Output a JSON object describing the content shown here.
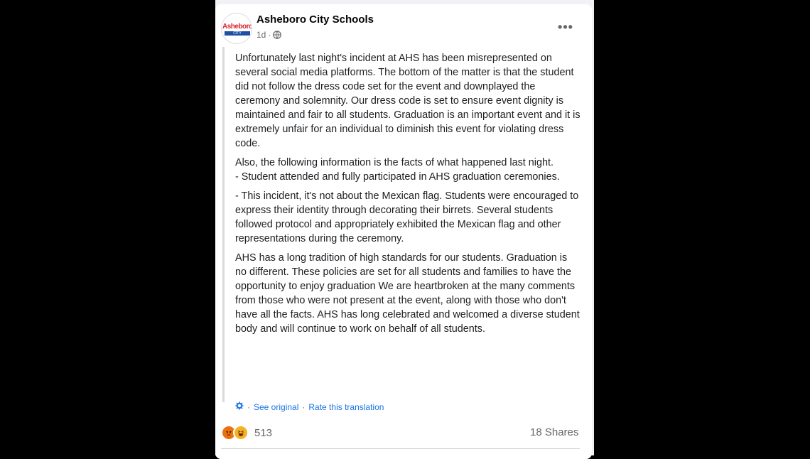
{
  "post": {
    "page_name": "Asheboro City Schools",
    "avatar_text": "Asheboro",
    "avatar_subtext": "CITY SCHOOLS",
    "time": "1d",
    "audience_icon": "globe-icon",
    "more_label": "•••",
    "paragraphs": [
      "Unfortunately last night's incident at AHS has been misrepresented on several social media platforms. The bottom of the matter is that the student did not follow the dress code set for the event and downplayed the ceremony and solemnity. Our dress code is set to ensure event dignity is maintained and fair to all students. Graduation is an important event and it is extremely unfair for an individual to diminish this event for violating dress code.",
      "Also, the following information is the facts of what happened last night.\n- Student attended and fully participated in AHS graduation ceremonies.",
      "- This incident, it's not about the Mexican flag. Students were encouraged to express their identity through decorating their birrets. Several students followed protocol and appropriately exhibited the Mexican flag and other representations during the ceremony.",
      "AHS has a long tradition of high standards for our students. Graduation is no different. These policies are set for all students and families to have the opportunity to enjoy graduation We are heartbroken at the many comments from those who were not present at the event, along with those who don't have all the facts. AHS has long celebrated and welcomed a diverse student body and will continue to work on behalf of all students."
    ],
    "translation": {
      "icon": "gear-icon",
      "see_original": "See original",
      "separator": "·",
      "rate": "Rate this translation"
    },
    "reactions": {
      "icons": [
        "angry-reaction-icon",
        "haha-reaction-icon"
      ],
      "count": "513"
    },
    "shares": "18 Shares"
  },
  "colors": {
    "link": "#1b74e4",
    "angry": "#e9710f",
    "haha": "#f7b125",
    "brand_red": "#d7282f",
    "brand_blue": "#1f4fa3"
  }
}
